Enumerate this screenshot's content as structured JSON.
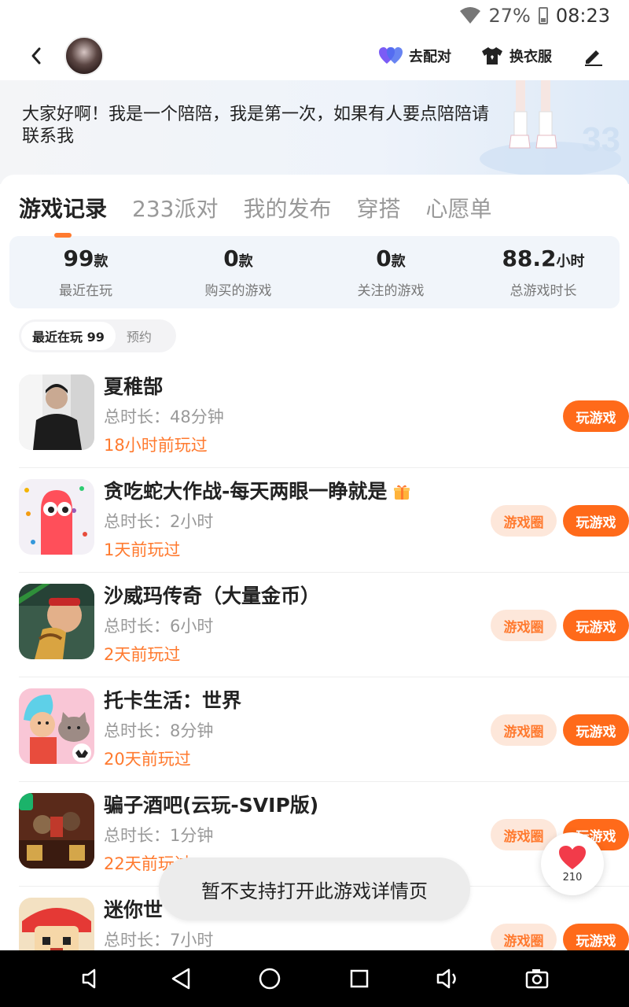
{
  "status_bar": {
    "battery": "27%",
    "time": "08:23"
  },
  "header": {
    "actions": [
      {
        "label": "去配对",
        "icon": "heart-pair-icon"
      },
      {
        "label": "换衣服",
        "icon": "shirt-icon"
      }
    ]
  },
  "profile": {
    "bio": "大家好啊！我是一个陪陪，我是第一次，如果有人要点陪陪请联系我"
  },
  "tabs": [
    {
      "label": "游戏记录",
      "active": true
    },
    {
      "label": "233派对"
    },
    {
      "label": "我的发布"
    },
    {
      "label": "穿搭"
    },
    {
      "label": "心愿单"
    }
  ],
  "stats": [
    {
      "value": "99",
      "unit": "款",
      "label": "最近在玩"
    },
    {
      "value": "0",
      "unit": "款",
      "label": "购买的游戏"
    },
    {
      "value": "0",
      "unit": "款",
      "label": "关注的游戏"
    },
    {
      "value": "88.2",
      "unit": "小时",
      "label": "总游戏时长"
    }
  ],
  "sub_tabs": [
    {
      "label": "最近在玩 99",
      "active": true
    },
    {
      "label": "预约"
    }
  ],
  "buttons": {
    "circle": "游戏圈",
    "play": "玩游戏"
  },
  "games": [
    {
      "name": "夏稚郜",
      "duration": "总时长：48分钟",
      "last_played": "18小时前玩过"
    },
    {
      "name": "贪吃蛇大作战-每天两眼一睁就是",
      "duration": "总时长：2小时",
      "last_played": "1天前玩过"
    },
    {
      "name": "沙威玛传奇（大量金币）",
      "duration": "总时长：6小时",
      "last_played": "2天前玩过"
    },
    {
      "name": "托卡生活：世界",
      "duration": "总时长：8分钟",
      "last_played": "20天前玩过"
    },
    {
      "name": "骗子酒吧(云玩-SVIP版)",
      "duration": "总时长：1分钟",
      "last_played": "22天前玩过"
    },
    {
      "name": "迷你世",
      "duration": "总时长：7小时",
      "last_played": ""
    }
  ],
  "toast": "暂不支持打开此游戏详情页",
  "like": {
    "count": "210"
  },
  "colors": {
    "accent": "#ff6a1a",
    "accent_light": "#fde7da",
    "stats_bg": "#f1f5fa"
  }
}
